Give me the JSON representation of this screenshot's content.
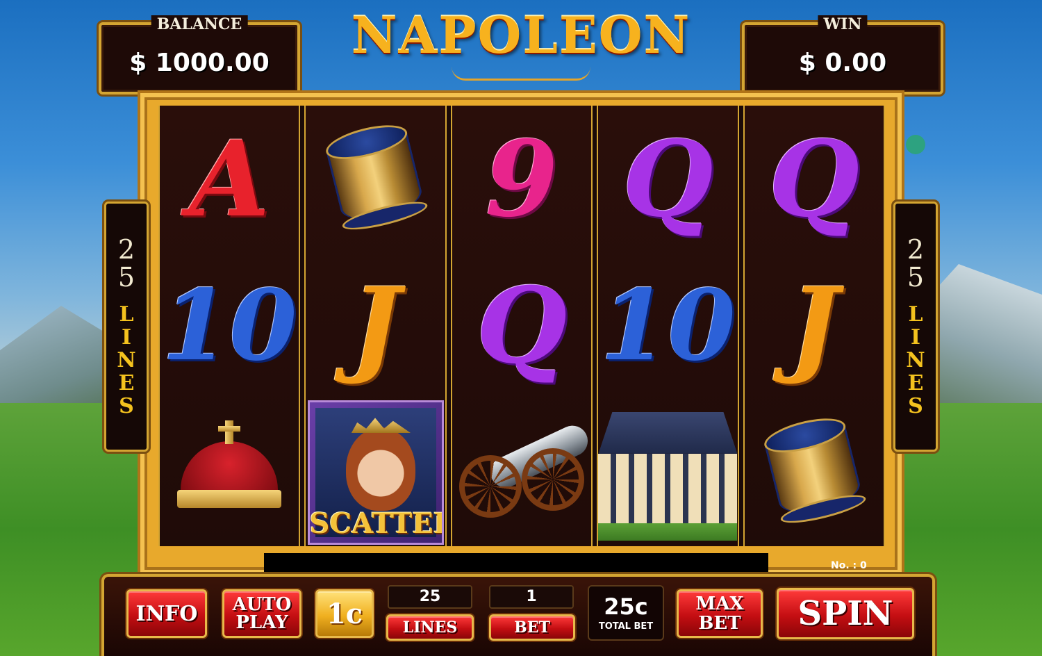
{
  "header": {
    "title": "NAPOLEON",
    "balance_label": "BALANCE",
    "balance_value": "$ 1000.00",
    "win_label": "WIN",
    "win_value": "$ 0.00"
  },
  "side_panels": {
    "lines_count": "25",
    "lines_word": "LINES"
  },
  "reels": [
    [
      {
        "symbol": "A",
        "type": "letter-a"
      },
      {
        "symbol": "10",
        "type": "ten"
      },
      {
        "symbol": "crown",
        "type": "crown-icon"
      }
    ],
    [
      {
        "symbol": "drum",
        "type": "drum-icon"
      },
      {
        "symbol": "J",
        "type": "jack"
      },
      {
        "symbol": "SCATTER",
        "type": "scatter"
      }
    ],
    [
      {
        "symbol": "9",
        "type": "nine"
      },
      {
        "symbol": "Q",
        "type": "queen"
      },
      {
        "symbol": "cannon",
        "type": "cannon-icon"
      }
    ],
    [
      {
        "symbol": "Q",
        "type": "queen"
      },
      {
        "symbol": "10",
        "type": "ten"
      },
      {
        "symbol": "palace",
        "type": "palace-icon"
      }
    ],
    [
      {
        "symbol": "Q",
        "type": "queen"
      },
      {
        "symbol": "J",
        "type": "jack"
      },
      {
        "symbol": "drum",
        "type": "drum-icon"
      }
    ]
  ],
  "status": {
    "game_number": "No. : 0"
  },
  "controls": {
    "info_label": "INFO",
    "autoplay_line1": "AUTO",
    "autoplay_line2": "PLAY",
    "coin_label": "1c",
    "lines_value": "25",
    "lines_label": "LINES",
    "bet_value": "1",
    "bet_label": "BET",
    "total_bet_value": "25c",
    "total_bet_label": "TOTAL BET",
    "maxbet_line1": "MAX",
    "maxbet_line2": "BET",
    "spin_label": "SPIN"
  },
  "colors": {
    "frame_gold": "#d4a532",
    "button_red": "#c40e12",
    "coin_gold": "#f0b020"
  }
}
